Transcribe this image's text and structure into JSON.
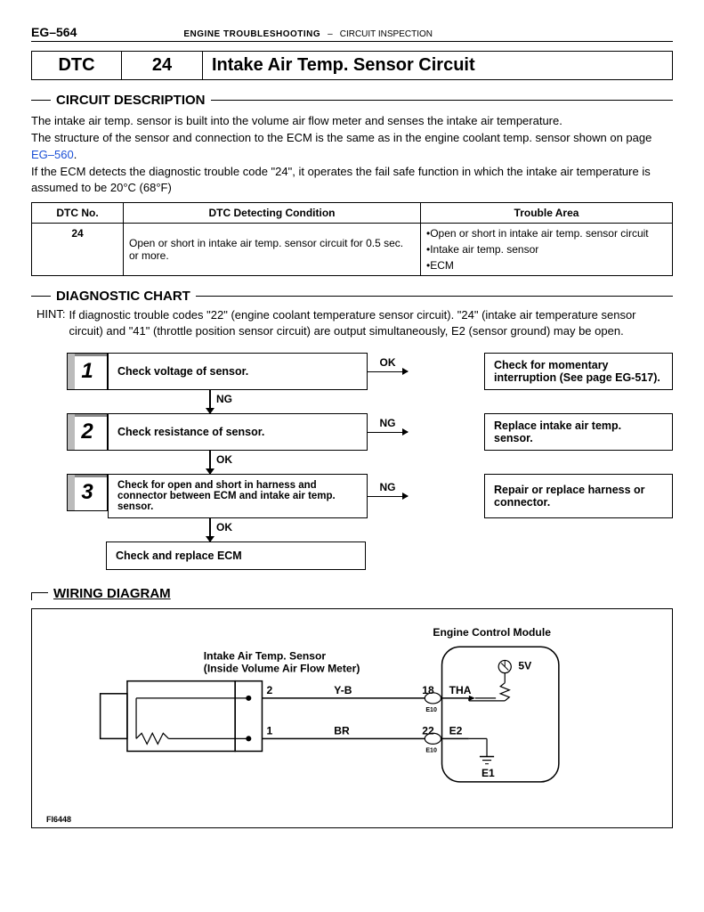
{
  "header": {
    "page_code": "EG–564",
    "section": "ENGINE TROUBLESHOOTING",
    "dash": "–",
    "subsection": "CIRCUIT INSPECTION"
  },
  "title_box": {
    "dtc": "DTC",
    "code": "24",
    "label": "Intake Air Temp. Sensor Circuit"
  },
  "sections": {
    "circuit_desc": "CIRCUIT DESCRIPTION",
    "diagnostic_chart": "DIAGNOSTIC CHART",
    "wiring": "WIRING DIAGRAM"
  },
  "circuit_text": {
    "p1": "The intake air temp. sensor is built into the volume air flow meter and senses the intake air temperature.",
    "p2a": "The structure of the sensor and connection to the ECM is the same as in the engine coolant temp. sensor shown on page ",
    "p2_link": "EG–560",
    "p2b": ".",
    "p3": "If the ECM detects the diagnostic trouble code \"24\", it operates the fail safe function in which the intake air temperature is assumed to be 20°C (68°F)"
  },
  "dtc_table": {
    "headers": {
      "no": "DTC No.",
      "cond": "DTC Detecting Condition",
      "area": "Trouble Area"
    },
    "row": {
      "no": "24",
      "cond": "Open or short in intake air temp. sensor circuit for 0.5 sec. or more.",
      "area1": "•Open or short in intake air temp. sensor circuit",
      "area2": "•Intake air temp. sensor",
      "area3": "•ECM"
    }
  },
  "hint": {
    "label": "HINT:",
    "text": "If diagnostic trouble codes \"22\" (engine coolant temperature sensor circuit). \"24\" (intake air temperature sensor circuit) and \"41\" (throttle position sensor circuit) are output simultaneously, E2 (sensor ground) may be open."
  },
  "flow": {
    "steps": [
      {
        "n": "1",
        "main": "Check voltage of sensor.",
        "h_label": "OK",
        "result": "Check for momentary interruption (See page EG-517).",
        "v_label": "NG"
      },
      {
        "n": "2",
        "main": "Check resistance of sensor.",
        "h_label": "NG",
        "result": "Replace intake air temp. sensor.",
        "v_label": "OK"
      },
      {
        "n": "3",
        "main": "Check for open and short in harness and connector between ECM and intake air temp. sensor.",
        "h_label": "NG",
        "result": "Repair or replace harness or connector.",
        "v_label": "OK"
      }
    ],
    "final": "Check and replace ECM"
  },
  "wiring": {
    "ecm_label": "Engine Control Module",
    "sensor_label1": "Intake Air Temp. Sensor",
    "sensor_label2": "(Inside Volume Air Flow Meter)",
    "pin2": "2",
    "wire1": "Y-B",
    "pin18": "18",
    "tha": "THA",
    "e10_1": "E10",
    "pin1": "1",
    "wire2": "BR",
    "pin22": "22",
    "e2": "E2",
    "e10_2": "E10",
    "v5": "5V",
    "e1": "E1",
    "fig_id": "FI6448"
  }
}
